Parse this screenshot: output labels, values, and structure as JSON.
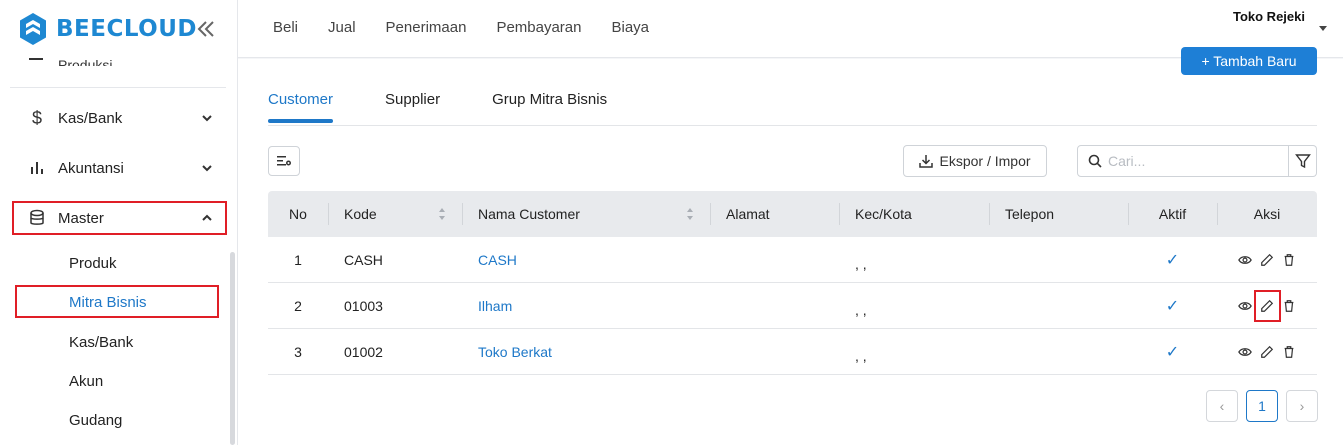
{
  "brand": {
    "name": "BEECLOUD",
    "color": "#1e88d2"
  },
  "sidebar": {
    "cut_item_label": "Produksi",
    "items": [
      {
        "label": "Kas/Bank",
        "icon": "dollar-icon"
      },
      {
        "label": "Akuntansi",
        "icon": "bar-chart-icon"
      },
      {
        "label": "Master",
        "icon": "database-icon"
      }
    ],
    "master_sub": [
      "Produk",
      "Mitra Bisnis",
      "Kas/Bank",
      "Akun",
      "Gudang"
    ]
  },
  "topbar": {
    "nav": [
      "Beli",
      "Jual",
      "Penerimaan",
      "Pembayaran",
      "Biaya"
    ],
    "company": "Toko Rejeki"
  },
  "main": {
    "add_button": "+ Tambah Baru",
    "tabs": [
      "Customer",
      "Supplier",
      "Grup Mitra Bisnis"
    ],
    "export_label": "Ekspor / Impor",
    "search_placeholder": "Cari..."
  },
  "table": {
    "headers": [
      "No",
      "Kode",
      "Nama Customer",
      "Alamat",
      "Kec/Kota",
      "Telepon",
      "Aktif",
      "Aksi"
    ],
    "rows": [
      {
        "no": "1",
        "kode": "CASH",
        "nama": "CASH",
        "alamat": "",
        "kota": ", ,",
        "telepon": "",
        "aktif": "✓"
      },
      {
        "no": "2",
        "kode": "01003",
        "nama": "Ilham",
        "alamat": "",
        "kota": ", ,",
        "telepon": "",
        "aktif": "✓"
      },
      {
        "no": "3",
        "kode": "01002",
        "nama": "Toko Berkat",
        "alamat": "",
        "kota": ", ,",
        "telepon": "",
        "aktif": "✓"
      }
    ]
  },
  "pagination": {
    "prev": "‹",
    "current": "1",
    "next": "›"
  },
  "colors": {
    "accent": "#1e78c8",
    "highlight": "#e01e26",
    "header_bg": "#e8eaed"
  }
}
